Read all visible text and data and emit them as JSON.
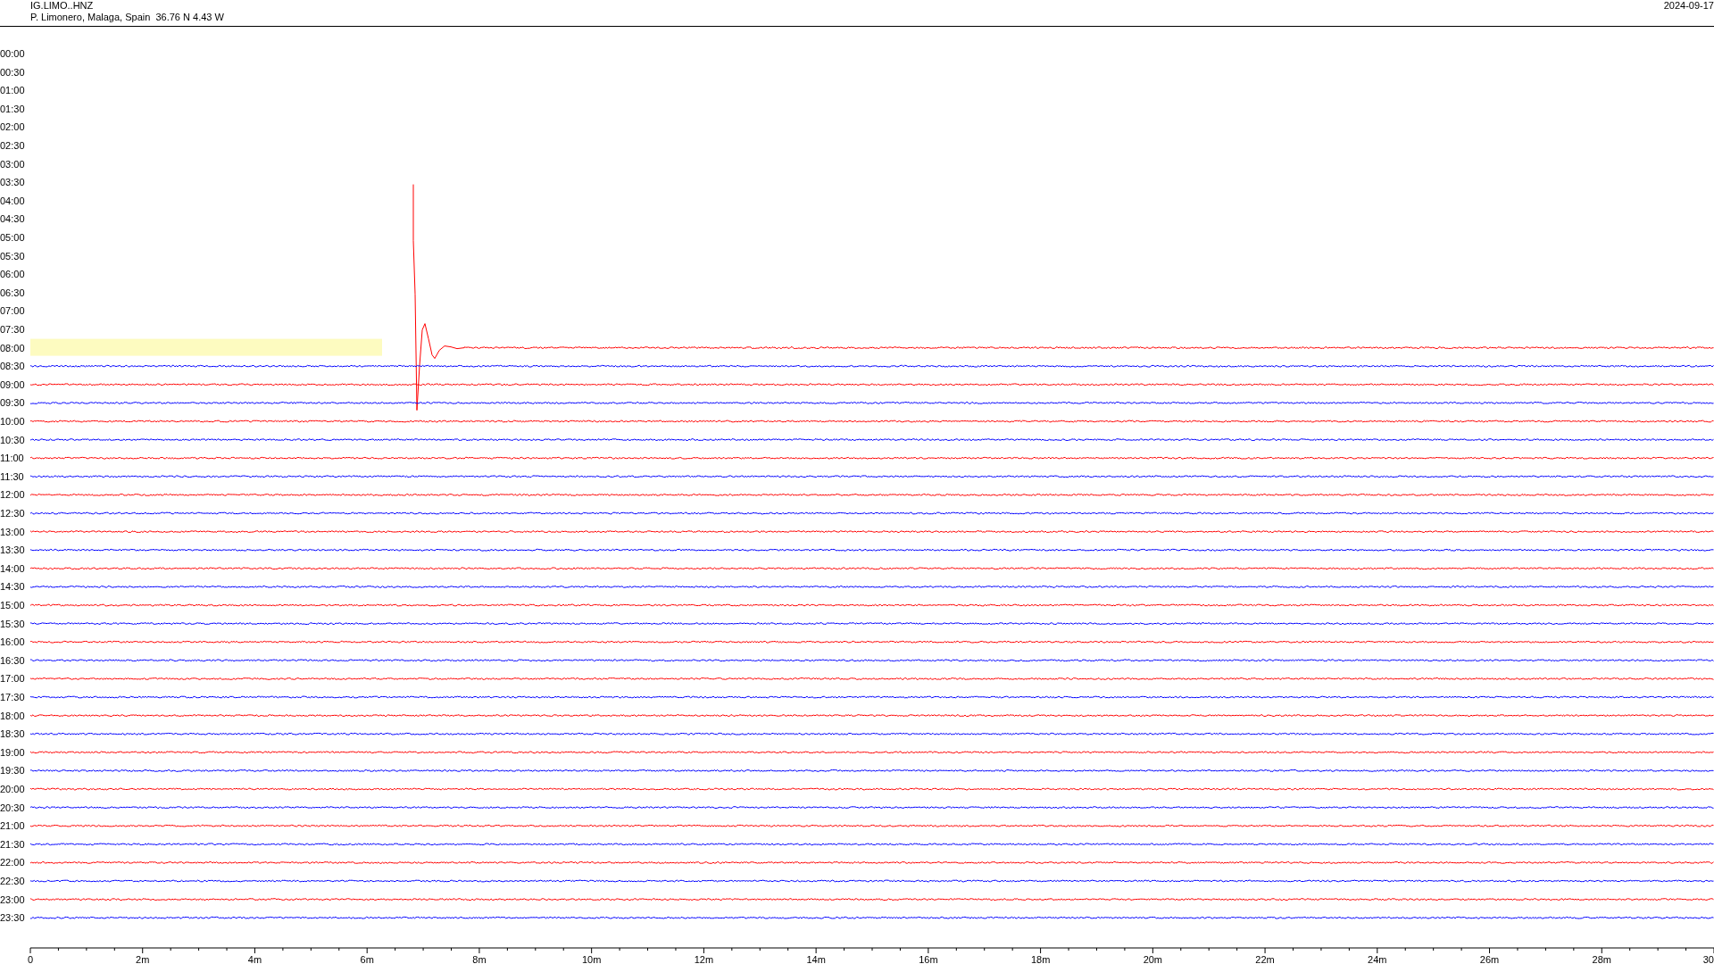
{
  "header": {
    "station": "IG.LIMO..HNZ",
    "location": "P. Limonero, Malaga, Spain  36.76 N 4.43 W",
    "date": "2024-09-17"
  },
  "rows": [
    {
      "label": "00:00",
      "trace": false,
      "highlight": false
    },
    {
      "label": "00:30",
      "trace": false,
      "highlight": false
    },
    {
      "label": "01:00",
      "trace": false,
      "highlight": false
    },
    {
      "label": "01:30",
      "trace": false,
      "highlight": false
    },
    {
      "label": "02:00",
      "trace": false,
      "highlight": false
    },
    {
      "label": "02:30",
      "trace": false,
      "highlight": false
    },
    {
      "label": "03:00",
      "trace": false,
      "highlight": false
    },
    {
      "label": "03:30",
      "trace": false,
      "highlight": false
    },
    {
      "label": "04:00",
      "trace": false,
      "highlight": false
    },
    {
      "label": "04:30",
      "trace": false,
      "highlight": false
    },
    {
      "label": "05:00",
      "trace": false,
      "highlight": false
    },
    {
      "label": "05:30",
      "trace": false,
      "highlight": false
    },
    {
      "label": "06:00",
      "trace": false,
      "highlight": false
    },
    {
      "label": "06:30",
      "trace": false,
      "highlight": false
    },
    {
      "label": "07:00",
      "trace": false,
      "highlight": false
    },
    {
      "label": "07:30",
      "trace": false,
      "highlight": false
    },
    {
      "label": "08:00",
      "trace": true,
      "highlight": true,
      "color": "#ff0000"
    },
    {
      "label": "08:30",
      "trace": true,
      "highlight": false,
      "color": "#0000ff"
    },
    {
      "label": "09:00",
      "trace": true,
      "highlight": false,
      "color": "#ff0000"
    },
    {
      "label": "09:30",
      "trace": true,
      "highlight": false,
      "color": "#0000ff"
    },
    {
      "label": "10:00",
      "trace": true,
      "highlight": false,
      "color": "#ff0000"
    },
    {
      "label": "10:30",
      "trace": true,
      "highlight": false,
      "color": "#0000ff"
    },
    {
      "label": "11:00",
      "trace": true,
      "highlight": false,
      "color": "#ff0000"
    },
    {
      "label": "11:30",
      "trace": true,
      "highlight": false,
      "color": "#0000ff"
    },
    {
      "label": "12:00",
      "trace": true,
      "highlight": false,
      "color": "#ff0000"
    },
    {
      "label": "12:30",
      "trace": true,
      "highlight": false,
      "color": "#0000ff"
    },
    {
      "label": "13:00",
      "trace": true,
      "highlight": false,
      "color": "#ff0000"
    },
    {
      "label": "13:30",
      "trace": true,
      "highlight": false,
      "color": "#0000ff"
    },
    {
      "label": "14:00",
      "trace": true,
      "highlight": false,
      "color": "#ff0000"
    },
    {
      "label": "14:30",
      "trace": true,
      "highlight": false,
      "color": "#0000ff"
    },
    {
      "label": "15:00",
      "trace": true,
      "highlight": false,
      "color": "#ff0000"
    },
    {
      "label": "15:30",
      "trace": true,
      "highlight": false,
      "color": "#0000ff"
    },
    {
      "label": "16:00",
      "trace": true,
      "highlight": false,
      "color": "#ff0000"
    },
    {
      "label": "16:30",
      "trace": true,
      "highlight": false,
      "color": "#0000ff"
    },
    {
      "label": "17:00",
      "trace": true,
      "highlight": false,
      "color": "#ff0000"
    },
    {
      "label": "17:30",
      "trace": true,
      "highlight": false,
      "color": "#0000ff"
    },
    {
      "label": "18:00",
      "trace": true,
      "highlight": false,
      "color": "#ff0000"
    },
    {
      "label": "18:30",
      "trace": true,
      "highlight": false,
      "color": "#0000ff"
    },
    {
      "label": "19:00",
      "trace": true,
      "highlight": false,
      "color": "#ff0000"
    },
    {
      "label": "19:30",
      "trace": true,
      "highlight": false,
      "color": "#0000ff"
    },
    {
      "label": "20:00",
      "trace": true,
      "highlight": false,
      "color": "#ff0000"
    },
    {
      "label": "20:30",
      "trace": true,
      "highlight": false,
      "color": "#0000ff"
    },
    {
      "label": "21:00",
      "trace": true,
      "highlight": false,
      "color": "#ff0000"
    },
    {
      "label": "21:30",
      "trace": true,
      "highlight": false,
      "color": "#0000ff"
    },
    {
      "label": "22:00",
      "trace": true,
      "highlight": false,
      "color": "#ff0000"
    },
    {
      "label": "22:30",
      "trace": true,
      "highlight": false,
      "color": "#0000ff"
    },
    {
      "label": "23:00",
      "trace": true,
      "highlight": false,
      "color": "#ff0000"
    },
    {
      "label": "23:30",
      "trace": true,
      "highlight": false,
      "color": "#0000ff"
    }
  ],
  "x_axis": {
    "ticks": [
      "0",
      "2m",
      "4m",
      "6m",
      "8m",
      "10m",
      "12m",
      "14m",
      "16m",
      "18m",
      "20m",
      "22m",
      "24m",
      "26m",
      "28m",
      "30"
    ]
  }
}
